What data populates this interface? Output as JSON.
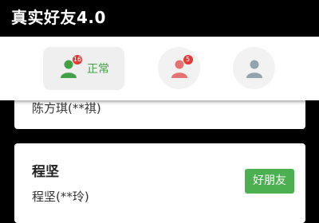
{
  "header": {
    "title": "真实好友4.0"
  },
  "filters": [
    {
      "icon": "person-icon",
      "color": "#43a047",
      "badge": "16",
      "label": "正常"
    },
    {
      "icon": "person-icon",
      "color": "#e57373",
      "badge": "5"
    },
    {
      "icon": "person-icon",
      "color": "#90a4ae"
    }
  ],
  "cards": [
    {
      "sub": "陈方琪(**祺)"
    },
    {
      "name": "程坚",
      "sub": "程坚(**玲)",
      "button": "好朋友"
    }
  ],
  "colors": {
    "accent_green": "#4caf50",
    "badge_red": "#e53935",
    "background": "#000000"
  }
}
